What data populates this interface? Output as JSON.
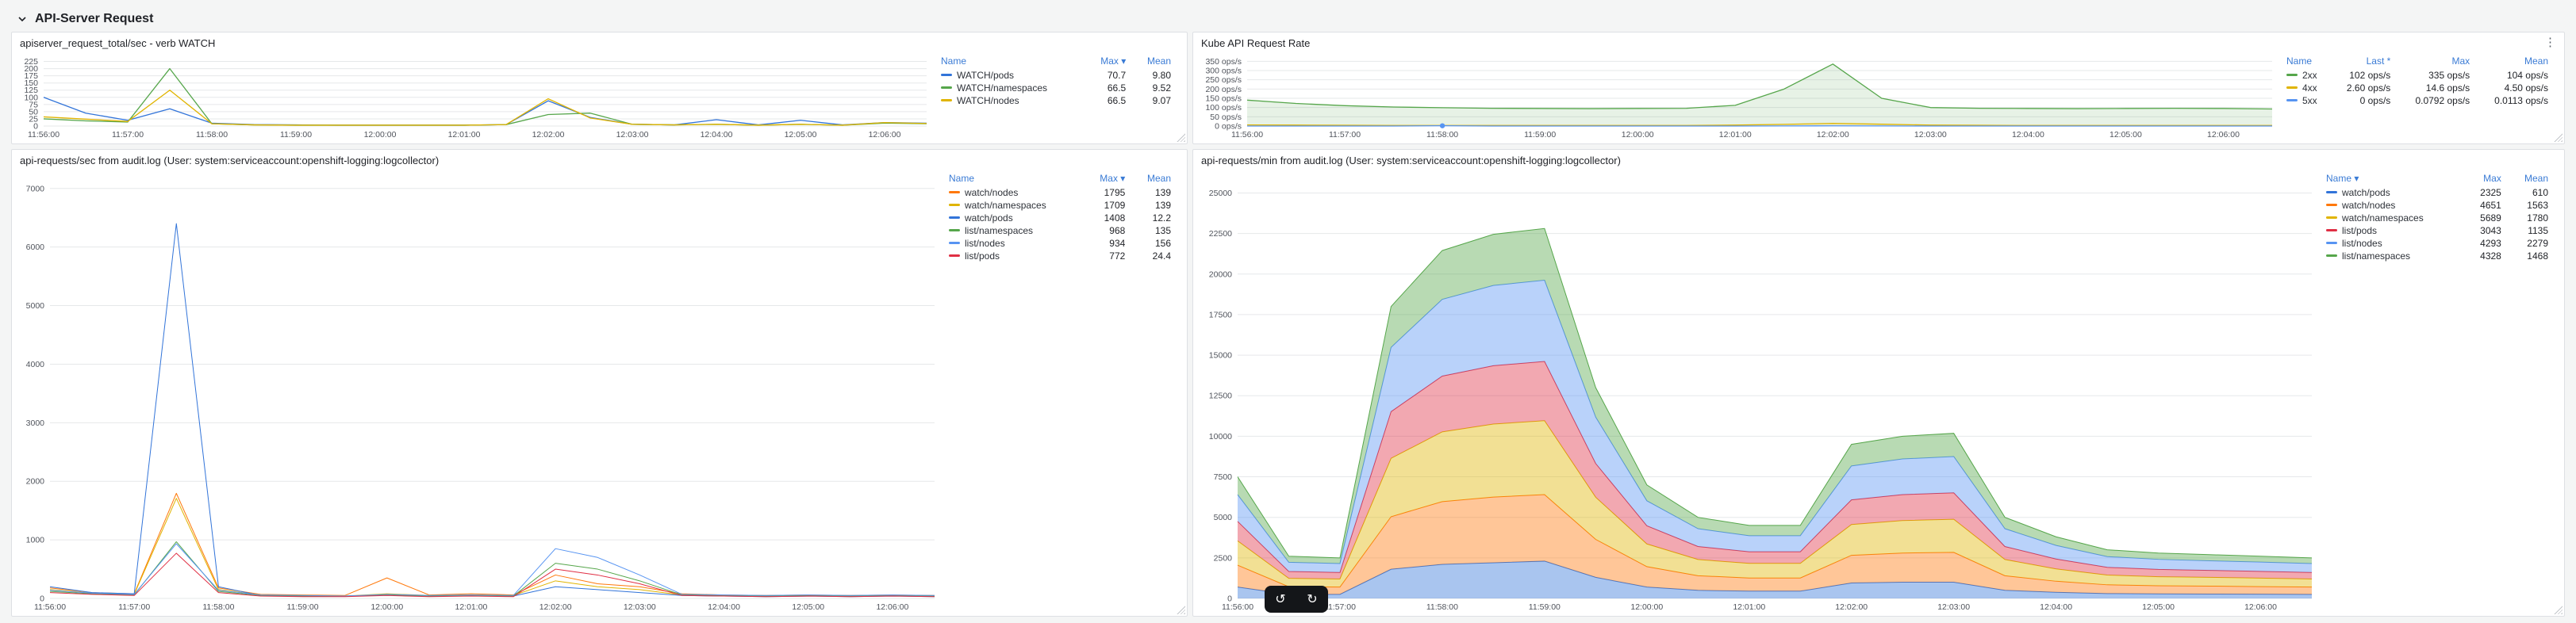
{
  "section": {
    "title": "API-Server Request"
  },
  "icons": {
    "kebab": "⋮",
    "undo": "↺",
    "redo": "↻"
  },
  "colors": {
    "blue": "#3274d9",
    "light_blue": "#5794f2",
    "green": "#56a64b",
    "yellow": "#e0b400",
    "orange": "#ff780a",
    "red": "#e02f44",
    "link": "#3a7bd5",
    "panel_bg": "#ffffff",
    "page_bg": "#f4f5f5"
  },
  "panels": [
    {
      "title": "apiserver_request_total/sec - verb WATCH",
      "legend": {
        "columns": [
          "Name",
          "Max ▾",
          "Mean"
        ],
        "rows": [
          {
            "color": "#3274d9",
            "name": "WATCH/pods",
            "values": [
              "70.7",
              "9.80"
            ]
          },
          {
            "color": "#56a64b",
            "name": "WATCH/namespaces",
            "values": [
              "66.5",
              "9.52"
            ]
          },
          {
            "color": "#e0b400",
            "name": "WATCH/nodes",
            "values": [
              "66.5",
              "9.07"
            ]
          }
        ]
      }
    },
    {
      "title": "Kube API Request Rate",
      "legend": {
        "columns": [
          "Name",
          "Last *",
          "Max",
          "Mean"
        ],
        "rows": [
          {
            "color": "#56a64b",
            "name": "2xx",
            "values": [
              "102 ops/s",
              "335 ops/s",
              "104 ops/s"
            ]
          },
          {
            "color": "#e0b400",
            "name": "4xx",
            "values": [
              "2.60 ops/s",
              "14.6 ops/s",
              "4.50 ops/s"
            ]
          },
          {
            "color": "#5794f2",
            "name": "5xx",
            "values": [
              "0 ops/s",
              "0.0792 ops/s",
              "0.0113 ops/s"
            ]
          }
        ]
      }
    },
    {
      "title": "api-requests/sec from audit.log (User: system:serviceaccount:openshift-logging:logcollector)",
      "legend": {
        "columns": [
          "Name",
          "Max ▾",
          "Mean"
        ],
        "rows": [
          {
            "color": "#ff780a",
            "name": "watch/nodes",
            "values": [
              "1795",
              "139"
            ]
          },
          {
            "color": "#e0b400",
            "name": "watch/namespaces",
            "values": [
              "1709",
              "139"
            ]
          },
          {
            "color": "#3274d9",
            "name": "watch/pods",
            "values": [
              "1408",
              "12.2"
            ]
          },
          {
            "color": "#56a64b",
            "name": "list/namespaces",
            "values": [
              "968",
              "135"
            ]
          },
          {
            "color": "#5794f2",
            "name": "list/nodes",
            "values": [
              "934",
              "156"
            ]
          },
          {
            "color": "#e02f44",
            "name": "list/pods",
            "values": [
              "772",
              "24.4"
            ]
          }
        ]
      }
    },
    {
      "title": "api-requests/min from audit.log (User: system:serviceaccount:openshift-logging:logcollector)",
      "legend": {
        "columns": [
          "Name ▾",
          "Max",
          "Mean"
        ],
        "rows": [
          {
            "color": "#3274d9",
            "name": "watch/pods",
            "values": [
              "2325",
              "610"
            ]
          },
          {
            "color": "#ff780a",
            "name": "watch/nodes",
            "values": [
              "4651",
              "1563"
            ]
          },
          {
            "color": "#e0b400",
            "name": "watch/namespaces",
            "values": [
              "5689",
              "1780"
            ]
          },
          {
            "color": "#e02f44",
            "name": "list/pods",
            "values": [
              "3043",
              "1135"
            ]
          },
          {
            "color": "#5794f2",
            "name": "list/nodes",
            "values": [
              "4293",
              "2279"
            ]
          },
          {
            "color": "#56a64b",
            "name": "list/namespaces",
            "values": [
              "4328",
              "1468"
            ]
          }
        ]
      }
    }
  ],
  "chart_data": [
    {
      "type": "line",
      "title": "apiserver_request_total/sec - verb WATCH",
      "xticks": [
        "11:56:00",
        "11:57:00",
        "11:58:00",
        "11:59:00",
        "12:00:00",
        "12:01:00",
        "12:02:00",
        "12:03:00",
        "12:04:00",
        "12:05:00",
        "12:06:00"
      ],
      "yticks": [
        225,
        200,
        175,
        150,
        125,
        100,
        75,
        50,
        25,
        0
      ],
      "ylim": [
        0,
        232
      ],
      "gutter_left": 36,
      "stroke_width": 1.3,
      "series": [
        {
          "name": "WATCH/pods",
          "color": "#3274d9",
          "values": [
            100,
            45,
            20,
            60,
            10,
            5,
            4,
            3,
            3,
            3,
            3,
            5,
            88,
            30,
            6,
            4,
            22,
            4,
            20,
            4,
            12,
            10
          ]
        },
        {
          "name": "WATCH/namespaces",
          "color": "#56a64b",
          "values": [
            25,
            18,
            14,
            200,
            8,
            4,
            3,
            3,
            3,
            3,
            3,
            5,
            40,
            45,
            6,
            4,
            6,
            3,
            6,
            3,
            10,
            8
          ]
        },
        {
          "name": "WATCH/nodes",
          "color": "#e0b400",
          "values": [
            32,
            24,
            16,
            125,
            8,
            4,
            3,
            3,
            3,
            3,
            3,
            5,
            95,
            28,
            6,
            4,
            6,
            3,
            6,
            3,
            12,
            9
          ]
        }
      ]
    },
    {
      "type": "line",
      "title": "Kube API Request Rate",
      "xticks": [
        "11:56:00",
        "11:57:00",
        "11:58:00",
        "11:59:00",
        "12:00:00",
        "12:01:00",
        "12:02:00",
        "12:03:00",
        "12:04:00",
        "12:05:00",
        "12:06:00"
      ],
      "yticks": [
        350,
        300,
        250,
        200,
        150,
        100,
        50,
        0
      ],
      "ytick_suffix": " ops/s",
      "ylim": [
        0,
        360
      ],
      "gutter_left": 64,
      "stroke_width": 1.3,
      "series": [
        {
          "name": "2xx",
          "color": "#56a64b",
          "fill": true,
          "fill_opacity": 0.14,
          "values": [
            140,
            122,
            110,
            103,
            99,
            96,
            95,
            94,
            95,
            96,
            112,
            200,
            335,
            150,
            100,
            96,
            95,
            94,
            95,
            96,
            95,
            92
          ]
        },
        {
          "name": "4xx",
          "color": "#e0b400",
          "fill": true,
          "fill_opacity": 0.12,
          "values": [
            6,
            5,
            4,
            3,
            3,
            3,
            3,
            3,
            3,
            3,
            5,
            9,
            14.6,
            10,
            5,
            4,
            3,
            3,
            3,
            3,
            3,
            3
          ]
        },
        {
          "name": "5xx",
          "color": "#5794f2",
          "marker_index": 4,
          "values": [
            0,
            0,
            0,
            0,
            1.5,
            0,
            0,
            0,
            0,
            0,
            0,
            0.5,
            1,
            0.5,
            0,
            0,
            0,
            0,
            0,
            0,
            0,
            0
          ]
        }
      ]
    },
    {
      "type": "line",
      "title": "api-requests/sec from audit.log",
      "xticks": [
        "11:56:00",
        "11:57:00",
        "11:58:00",
        "11:59:00",
        "12:00:00",
        "12:01:00",
        "12:02:00",
        "12:03:00",
        "12:04:00",
        "12:05:00",
        "12:06:00"
      ],
      "yticks": [
        7000,
        6000,
        5000,
        4000,
        3000,
        2000,
        1000,
        0
      ],
      "ylim": [
        0,
        7200
      ],
      "gutter_left": 44,
      "stroke_width": 1,
      "series": [
        {
          "name": "watch/nodes",
          "color": "#ff780a",
          "values": [
            180,
            100,
            80,
            1795,
            180,
            70,
            60,
            50,
            350,
            60,
            80,
            60,
            400,
            250,
            200,
            80,
            60,
            50,
            60,
            50,
            60,
            50
          ]
        },
        {
          "name": "watch/namespaces",
          "color": "#e0b400",
          "values": [
            150,
            90,
            70,
            1709,
            150,
            60,
            50,
            40,
            80,
            50,
            60,
            50,
            300,
            200,
            150,
            60,
            50,
            40,
            50,
            40,
            50,
            40
          ]
        },
        {
          "name": "watch/pods",
          "color": "#3274d9",
          "values": [
            200,
            100,
            80,
            6400,
            200,
            50,
            40,
            40,
            60,
            40,
            50,
            40,
            200,
            150,
            100,
            50,
            40,
            30,
            40,
            30,
            40,
            30
          ]
        },
        {
          "name": "list/namespaces",
          "color": "#56a64b",
          "values": [
            120,
            80,
            60,
            968,
            120,
            50,
            40,
            40,
            60,
            40,
            50,
            40,
            600,
            500,
            300,
            60,
            50,
            40,
            50,
            40,
            50,
            40
          ]
        },
        {
          "name": "list/nodes",
          "color": "#5794f2",
          "values": [
            140,
            90,
            70,
            934,
            140,
            60,
            50,
            40,
            70,
            50,
            60,
            50,
            850,
            700,
            400,
            70,
            60,
            50,
            60,
            50,
            60,
            50
          ]
        },
        {
          "name": "list/pods",
          "color": "#e02f44",
          "values": [
            100,
            70,
            50,
            772,
            100,
            40,
            30,
            30,
            50,
            30,
            40,
            30,
            500,
            400,
            250,
            50,
            40,
            30,
            40,
            30,
            40,
            30
          ]
        }
      ]
    },
    {
      "type": "stacked",
      "title": "api-requests/min from audit.log",
      "xticks": [
        "11:56:00",
        "11:57:00",
        "11:58:00",
        "11:59:00",
        "12:00:00",
        "12:01:00",
        "12:02:00",
        "12:03:00",
        "12:04:00",
        "12:05:00",
        "12:06:00"
      ],
      "yticks": [
        25000,
        22500,
        20000,
        17500,
        15000,
        12500,
        10000,
        7500,
        5000,
        2500,
        0
      ],
      "ylim": [
        0,
        26000
      ],
      "gutter_left": 52,
      "stroke_width": 1,
      "fill_opacity": 0.42,
      "series": [
        {
          "name": "watch/pods",
          "color": "#3274d9",
          "values": [
            700,
            250,
            250,
            1800,
            2100,
            2200,
            2300,
            1300,
            700,
            500,
            450,
            450,
            950,
            1000,
            1000,
            500,
            380,
            300,
            280,
            270,
            260,
            250
          ]
        },
        {
          "name": "watch/nodes",
          "color": "#ff780a",
          "values": [
            1350,
            470,
            450,
            3240,
            3870,
            4050,
            4100,
            2340,
            1260,
            900,
            810,
            810,
            1710,
            1800,
            1840,
            900,
            680,
            540,
            500,
            490,
            470,
            450
          ]
        },
        {
          "name": "watch/namespaces",
          "color": "#e0b400",
          "values": [
            1500,
            520,
            500,
            3600,
            4300,
            4500,
            4560,
            2600,
            1400,
            1000,
            900,
            900,
            1900,
            2000,
            2040,
            1000,
            760,
            600,
            560,
            540,
            520,
            500
          ]
        },
        {
          "name": "list/pods",
          "color": "#e02f44",
          "values": [
            1200,
            420,
            400,
            2880,
            3440,
            3600,
            3650,
            2080,
            1120,
            800,
            720,
            720,
            1520,
            1600,
            1630,
            800,
            610,
            480,
            450,
            430,
            420,
            400
          ]
        },
        {
          "name": "list/nodes",
          "color": "#5794f2",
          "values": [
            1650,
            570,
            550,
            3960,
            4730,
            4950,
            5010,
            2860,
            1540,
            1100,
            990,
            990,
            2090,
            2200,
            2240,
            1100,
            840,
            660,
            620,
            590,
            570,
            550
          ]
        },
        {
          "name": "list/namespaces",
          "color": "#56a64b",
          "values": [
            1100,
            370,
            350,
            2520,
            3010,
            3150,
            3190,
            1820,
            980,
            700,
            630,
            630,
            1330,
            1400,
            1430,
            700,
            530,
            420,
            390,
            380,
            360,
            350
          ]
        }
      ]
    }
  ]
}
